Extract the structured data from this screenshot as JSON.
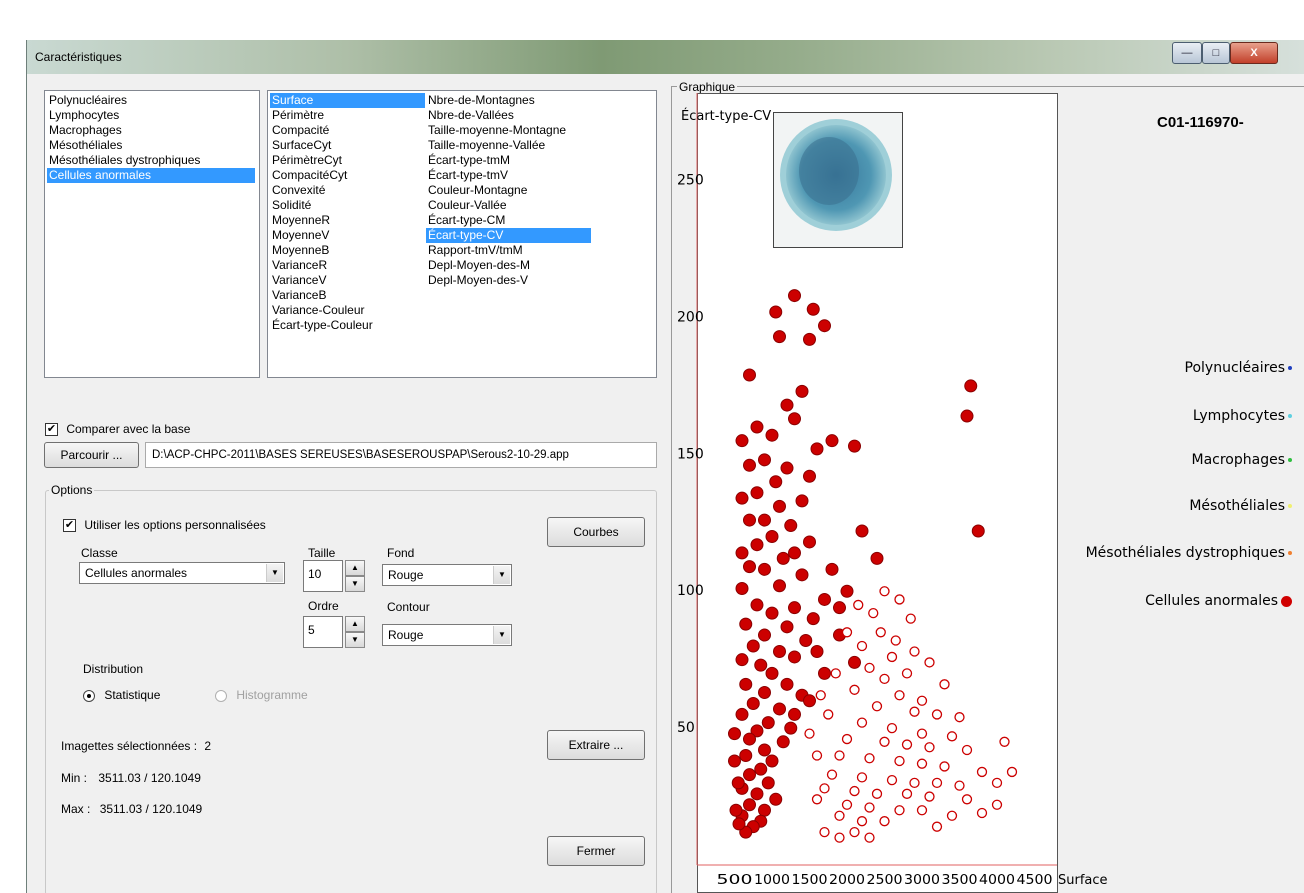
{
  "window": {
    "title": "Caractéristiques",
    "close_glyph": "X",
    "min_glyph": "—",
    "max_glyph": "□"
  },
  "classes": [
    "Polynucléaires",
    "Lymphocytes",
    "Macrophages",
    "Mésothéliales",
    "Mésothéliales dystrophiques",
    "Cellules anormales"
  ],
  "classes_selected": 5,
  "features_col1": [
    "Surface",
    "Périmètre",
    "Compacité",
    "SurfaceCyt",
    "PérimètreCyt",
    "CompacitéCyt",
    "Convexité",
    "Solidité",
    "MoyenneR",
    "MoyenneV",
    "MoyenneB",
    "VarianceR",
    "VarianceV",
    "VarianceB",
    "Variance-Couleur",
    "Écart-type-Couleur"
  ],
  "features_col2": [
    "Nbre-de-Montagnes",
    "Nbre-de-Vallées",
    "Taille-moyenne-Montagne",
    "Taille-moyenne-Vallée",
    "Écart-type-tmM",
    "Écart-type-tmV",
    "Couleur-Montagne",
    "Couleur-Vallée",
    "Écart-type-CM",
    "Écart-type-CV",
    "Rapport-tmV/tmM",
    "Depl-Moyen-des-M",
    "Depl-Moyen-des-V"
  ],
  "features_col1_selected": 0,
  "features_col2_selected": 9,
  "compare": {
    "label": "Comparer avec la base",
    "checked": true
  },
  "browse": {
    "label": "Parcourir ...",
    "path": "D:\\ACP-CHPC-2011\\BASES SEREUSES\\BASESEROUSPAP\\Serous2-10-29.app"
  },
  "options": {
    "group_label": "Options",
    "custom_label": "Utiliser les options personnalisées",
    "custom_checked": true,
    "courbes_label": "Courbes",
    "classe_label": "Classe",
    "classe_value": "Cellules anormales",
    "taille_label": "Taille",
    "taille_value": "10",
    "ordre_label": "Ordre",
    "ordre_value": "5",
    "fond_label": "Fond",
    "fond_value": "Rouge",
    "contour_label": "Contour",
    "contour_value": "Rouge",
    "distribution_label": "Distribution",
    "stat_label": "Statistique",
    "histo_label": "Histogramme"
  },
  "selection": {
    "imagettes_label": "Imagettes sélectionnées :",
    "imagettes_value": "2",
    "min_label": "Min :",
    "min_value": "3511.03 / 120.1049",
    "max_label": "Max :",
    "max_value": "3511.03 / 120.1049"
  },
  "buttons": {
    "extraire": "Extraire ...",
    "fermer": "Fermer"
  },
  "graph": {
    "group_label": "Graphique",
    "cell_id": "C01-116970-"
  },
  "legend": [
    {
      "name": "Polynucléaires",
      "color": "#1f3fbf"
    },
    {
      "name": "Lymphocytes",
      "color": "#5fd0e0"
    },
    {
      "name": "Macrophages",
      "color": "#2fbf3f"
    },
    {
      "name": "Mésothéliales",
      "color": "#f0f070"
    },
    {
      "name": "Mésothéliales dystrophiques",
      "color": "#f08030"
    },
    {
      "name": "Cellules anormales",
      "color": "#d00000"
    }
  ],
  "chart_data": {
    "type": "scatter",
    "xlabel": "Surface",
    "ylabel": "Écart-type-CV",
    "x_ticks": [
      500,
      1000,
      1500,
      2000,
      2500,
      3000,
      3500,
      4000,
      4500
    ],
    "y_ticks": [
      50,
      100,
      150,
      200,
      250
    ],
    "xlim": [
      0,
      4800
    ],
    "ylim": [
      0,
      282
    ],
    "series": [
      {
        "name": "Cellules anormales",
        "marker": "filled",
        "color": "#cc0000",
        "points": [
          [
            1300,
            208
          ],
          [
            1050,
            202
          ],
          [
            1550,
            203
          ],
          [
            1700,
            197
          ],
          [
            1500,
            192
          ],
          [
            1100,
            193
          ],
          [
            700,
            179
          ],
          [
            3650,
            175
          ],
          [
            1400,
            173
          ],
          [
            1200,
            168
          ],
          [
            3600,
            164
          ],
          [
            1300,
            163
          ],
          [
            800,
            160
          ],
          [
            1000,
            157
          ],
          [
            600,
            155
          ],
          [
            2100,
            153
          ],
          [
            1800,
            155
          ],
          [
            1600,
            152
          ],
          [
            900,
            148
          ],
          [
            700,
            146
          ],
          [
            1200,
            145
          ],
          [
            1500,
            142
          ],
          [
            1050,
            140
          ],
          [
            800,
            136
          ],
          [
            600,
            134
          ],
          [
            1400,
            133
          ],
          [
            1100,
            131
          ],
          [
            700,
            126
          ],
          [
            900,
            126
          ],
          [
            1250,
            124
          ],
          [
            2200,
            122
          ],
          [
            1000,
            120
          ],
          [
            3750,
            122
          ],
          [
            1500,
            118
          ],
          [
            800,
            117
          ],
          [
            600,
            114
          ],
          [
            1300,
            114
          ],
          [
            1150,
            112
          ],
          [
            700,
            109
          ],
          [
            2400,
            112
          ],
          [
            900,
            108
          ],
          [
            1800,
            108
          ],
          [
            1400,
            106
          ],
          [
            1100,
            102
          ],
          [
            600,
            101
          ],
          [
            2000,
            100
          ],
          [
            1700,
            97
          ],
          [
            800,
            95
          ],
          [
            1300,
            94
          ],
          [
            1000,
            92
          ],
          [
            1550,
            90
          ],
          [
            650,
            88
          ],
          [
            1200,
            87
          ],
          [
            900,
            84
          ],
          [
            1450,
            82
          ],
          [
            750,
            80
          ],
          [
            1900,
            84
          ],
          [
            1100,
            78
          ],
          [
            600,
            75
          ],
          [
            1300,
            76
          ],
          [
            850,
            73
          ],
          [
            1000,
            70
          ],
          [
            1700,
            70
          ],
          [
            650,
            66
          ],
          [
            1200,
            66
          ],
          [
            900,
            63
          ],
          [
            1400,
            62
          ],
          [
            750,
            59
          ],
          [
            1100,
            57
          ],
          [
            600,
            55
          ],
          [
            1300,
            55
          ],
          [
            950,
            52
          ],
          [
            800,
            49
          ],
          [
            700,
            46
          ],
          [
            1150,
            45
          ],
          [
            900,
            42
          ],
          [
            650,
            40
          ],
          [
            1000,
            38
          ],
          [
            850,
            35
          ],
          [
            700,
            33
          ],
          [
            950,
            30
          ],
          [
            600,
            28
          ],
          [
            800,
            26
          ],
          [
            1050,
            24
          ],
          [
            700,
            22
          ],
          [
            900,
            20
          ],
          [
            600,
            18
          ],
          [
            850,
            16
          ],
          [
            750,
            14
          ],
          [
            650,
            12
          ],
          [
            500,
            48
          ],
          [
            500,
            38
          ],
          [
            550,
            30
          ],
          [
            520,
            20
          ],
          [
            560,
            15
          ],
          [
            1250,
            50
          ],
          [
            1500,
            60
          ],
          [
            1600,
            78
          ],
          [
            2100,
            74
          ],
          [
            1900,
            94
          ]
        ]
      },
      {
        "name": "Cellules anormales (base)",
        "marker": "hollow",
        "color": "#cc0000",
        "points": [
          [
            2500,
            100
          ],
          [
            2700,
            97
          ],
          [
            2350,
            92
          ],
          [
            2850,
            90
          ],
          [
            2450,
            85
          ],
          [
            2650,
            82
          ],
          [
            2200,
            80
          ],
          [
            2900,
            78
          ],
          [
            2600,
            76
          ],
          [
            3100,
            74
          ],
          [
            2300,
            72
          ],
          [
            2800,
            70
          ],
          [
            2500,
            68
          ],
          [
            3300,
            66
          ],
          [
            2100,
            64
          ],
          [
            2700,
            62
          ],
          [
            3000,
            60
          ],
          [
            2400,
            58
          ],
          [
            2900,
            56
          ],
          [
            3200,
            55
          ],
          [
            3500,
            54
          ],
          [
            2200,
            52
          ],
          [
            2600,
            50
          ],
          [
            3000,
            48
          ],
          [
            3400,
            47
          ],
          [
            2000,
            46
          ],
          [
            2500,
            45
          ],
          [
            2800,
            44
          ],
          [
            3100,
            43
          ],
          [
            3600,
            42
          ],
          [
            4100,
            45
          ],
          [
            1900,
            40
          ],
          [
            2300,
            39
          ],
          [
            2700,
            38
          ],
          [
            3000,
            37
          ],
          [
            3300,
            36
          ],
          [
            3800,
            34
          ],
          [
            4200,
            34
          ],
          [
            1800,
            33
          ],
          [
            2200,
            32
          ],
          [
            2600,
            31
          ],
          [
            2900,
            30
          ],
          [
            3200,
            30
          ],
          [
            3500,
            29
          ],
          [
            4000,
            30
          ],
          [
            1700,
            28
          ],
          [
            2100,
            27
          ],
          [
            2400,
            26
          ],
          [
            2800,
            26
          ],
          [
            3100,
            25
          ],
          [
            3600,
            24
          ],
          [
            4000,
            22
          ],
          [
            1600,
            24
          ],
          [
            2000,
            22
          ],
          [
            2300,
            21
          ],
          [
            2700,
            20
          ],
          [
            3000,
            20
          ],
          [
            3400,
            18
          ],
          [
            3800,
            19
          ],
          [
            1900,
            18
          ],
          [
            2200,
            16
          ],
          [
            2500,
            16
          ],
          [
            3200,
            14
          ],
          [
            1700,
            12
          ],
          [
            2100,
            12
          ],
          [
            1900,
            10
          ],
          [
            2300,
            10
          ],
          [
            1600,
            40
          ],
          [
            1750,
            55
          ],
          [
            1850,
            70
          ],
          [
            2000,
            85
          ],
          [
            2150,
            95
          ],
          [
            1500,
            48
          ],
          [
            1650,
            62
          ]
        ]
      }
    ]
  }
}
